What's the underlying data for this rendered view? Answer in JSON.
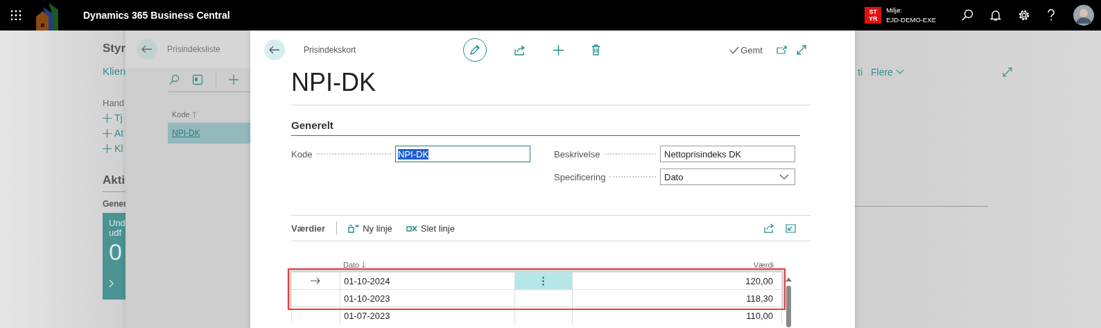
{
  "app_bar": {
    "title": "Dynamics 365 Business Central",
    "badge_lines": [
      "ST",
      "YR"
    ],
    "environment_label": "Miljø:",
    "environment_name": "EJD-DEMO-EXE"
  },
  "background_page": {
    "title": "Styr",
    "nav_link": "Klien",
    "section_label": "Hand",
    "actions": [
      "Tj",
      "At",
      "Kl"
    ],
    "activities_title": "Akti",
    "group_label": "Gener",
    "tile": {
      "lines": [
        "Und",
        "udf"
      ],
      "value": "0"
    },
    "nav_right": [
      {
        "label": "ti",
        "kind": "link"
      },
      {
        "label": "Flere",
        "kind": "menu"
      }
    ]
  },
  "list_page": {
    "title": "Prisindeksliste",
    "column": "Kode",
    "rows": [
      {
        "code": "NPI-DK",
        "selected": true
      }
    ]
  },
  "card": {
    "breadcrumb": "Prisindekskort",
    "status": "Gemt",
    "title": "NPI-DK",
    "section": "Generelt",
    "fields": [
      {
        "label": "Kode",
        "value": "NPI-DK",
        "kind": "text",
        "focused": true
      },
      {
        "label": "Beskrivelse",
        "value": "Nettoprisindeks DK",
        "kind": "text",
        "focused": false
      },
      {
        "label": "Specificering",
        "value": "Dato",
        "kind": "select",
        "focused": false
      }
    ],
    "lines": {
      "title": "Værdier",
      "actions": [
        {
          "label": "Ny linje",
          "kind": "new"
        },
        {
          "label": "Slet linje",
          "kind": "delete"
        }
      ],
      "columns": [
        "Dato",
        "Værdi"
      ],
      "rows": [
        {
          "date": "01-10-2024",
          "value": "120,00",
          "current": true,
          "highlighted": true
        },
        {
          "date": "01-10-2023",
          "value": "118,30",
          "current": false,
          "highlighted": true
        },
        {
          "date": "01-07-2023",
          "value": "110,00",
          "current": false,
          "highlighted": false
        }
      ]
    }
  }
}
